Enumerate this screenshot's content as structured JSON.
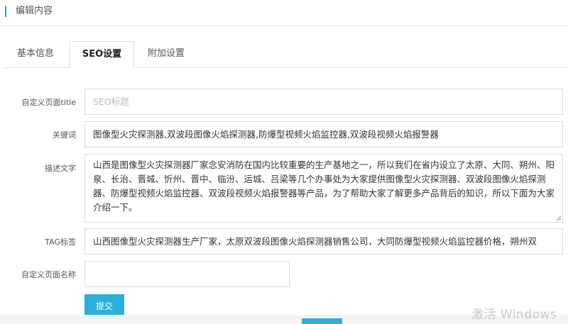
{
  "header": {
    "title": "编辑内容"
  },
  "tabs": [
    {
      "label": "基本信息",
      "active": false
    },
    {
      "label": "SEO设置",
      "active": true
    },
    {
      "label": "附加设置",
      "active": false
    }
  ],
  "form": {
    "page_title": {
      "label": "自定义页面title",
      "value": "",
      "placeholder": "SEO标题"
    },
    "keywords": {
      "label": "关键词",
      "value": "图像型火灾探测器,双波段图像火焰探测器,防爆型视频火焰监控器,双波段视频火焰报警器"
    },
    "description": {
      "label": "描述文字",
      "value": "山西是图像型火灾探测器厂家念安消防在国内比较重要的生产基地之一，所以我们在省内设立了太原、大同、朔州、阳泉、长治、晋城、忻州、晋中、临汾、运城、吕梁等几个办事处为大家提供图像型火灾探测器、双波段图像火焰探测器、防爆型视频火焰监控器、双波段视频火焰报警器等产品，为了帮助大家了解更多产品背后的知识，所以下面为大家介绍一下。"
    },
    "tags": {
      "label": "TAG标签",
      "value": "山西图像型火灾探测器生产厂家，太原双波段图像火焰探测器销售公司，大同防爆型视频火焰监控器价格，朔州双"
    },
    "page_name": {
      "label": "自定义页面名称",
      "value": ""
    },
    "submit_label": "提交"
  },
  "watermark": "激活 Windows",
  "colors": {
    "accent": "#2bb0d9",
    "border": "#dcdcdc",
    "placeholder": "#bbbbbb"
  }
}
